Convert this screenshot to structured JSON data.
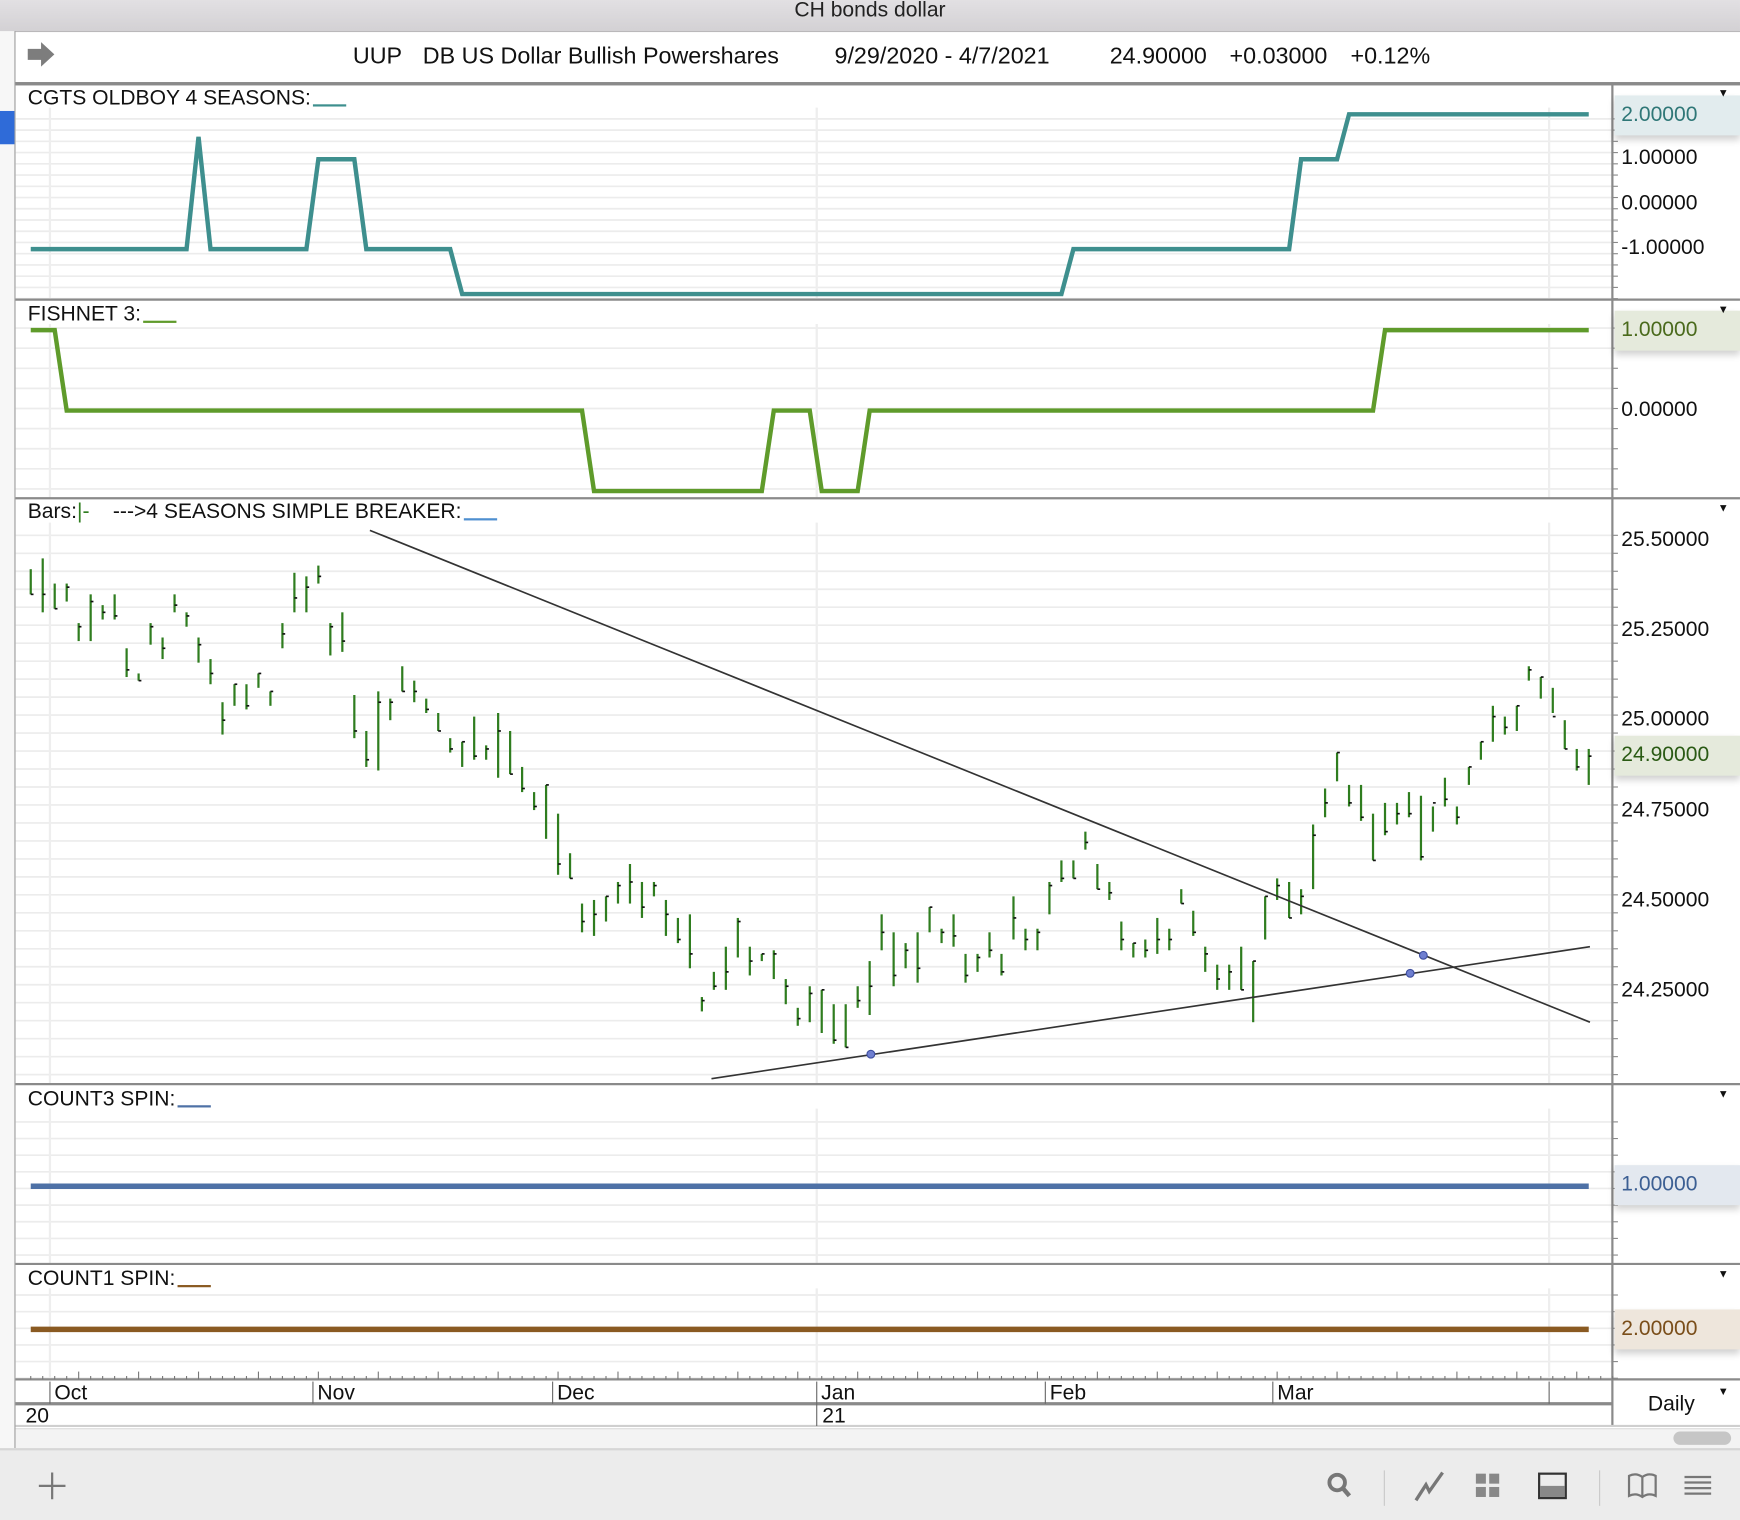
{
  "window": {
    "title": "CH bonds dollar"
  },
  "header": {
    "symbol": "UUP",
    "name": "DB US Dollar Bullish Powershares",
    "range": "9/29/2020 - 4/7/2021",
    "last": "24.90000",
    "change": "+0.03000",
    "pct": "+0.12%"
  },
  "colors": {
    "teal": "#3e8f8e",
    "fishnet": "#5f9b2b",
    "bars": "#2f7d1f",
    "count3": "#4e71a6",
    "count1": "#8a5a22",
    "accent": "#2f6bd8"
  },
  "panels": {
    "p1": {
      "label": "CGTS OLDBOY 4 SEASONS:",
      "ticks": [
        "1.00000",
        "0.00000",
        "-1.00000"
      ],
      "current": "2.00000"
    },
    "p2": {
      "label": "FISHNET 3:",
      "ticks": [
        "0.00000"
      ],
      "current": "1.00000"
    },
    "p3": {
      "label_bars": "Bars:",
      "label_bar_style": "|-",
      "label": "--->4 SEASONS SIMPLE BREAKER:",
      "ticks": [
        "25.50000",
        "25.25000",
        "25.00000",
        "24.75000",
        "24.50000",
        "24.25000"
      ],
      "current": "24.90000"
    },
    "p4": {
      "label": "COUNT3 SPIN:",
      "current": "1.00000"
    },
    "p5": {
      "label": "COUNT1 SPIN:",
      "current": "2.00000"
    }
  },
  "xaxis": {
    "months": [
      "Oct",
      "Nov",
      "Dec",
      "Jan",
      "Feb",
      "Mar"
    ],
    "years": [
      "20",
      "21"
    ],
    "interval": "Daily"
  },
  "toolbar": {
    "items": [
      "add",
      "search",
      "line-chart",
      "grid",
      "panel",
      "book",
      "menu"
    ]
  },
  "chart_data": {
    "type": "ohlc-bar",
    "title": "UUP DB US Dollar Bullish Powershares",
    "x_range": [
      "9/29/2020",
      "4/7/2021"
    ],
    "ylim": [
      24.0,
      25.6
    ],
    "bars_hlc": [
      [
        25.42,
        25.35,
        25.35
      ],
      [
        25.45,
        25.3,
        25.35
      ],
      [
        25.38,
        25.31,
        25.31
      ],
      [
        25.38,
        25.33,
        25.37
      ],
      [
        25.27,
        25.22,
        25.26
      ],
      [
        25.35,
        25.22,
        25.33
      ],
      [
        25.32,
        25.28,
        25.3
      ],
      [
        25.35,
        25.28,
        25.29
      ],
      [
        25.2,
        25.12,
        25.14
      ],
      [
        25.13,
        25.11,
        25.11
      ],
      [
        25.27,
        25.21,
        25.26
      ],
      [
        25.23,
        25.17,
        25.2
      ],
      [
        25.35,
        25.3,
        25.32
      ],
      [
        25.3,
        25.26,
        25.29
      ],
      [
        25.23,
        25.16,
        25.21
      ],
      [
        25.17,
        25.1,
        25.13
      ],
      [
        25.05,
        24.96,
        25.0
      ],
      [
        25.1,
        25.04,
        25.1
      ],
      [
        25.1,
        25.03,
        25.04
      ],
      [
        25.13,
        25.09,
        25.13
      ],
      [
        25.08,
        25.04,
        25.08
      ],
      [
        25.27,
        25.2,
        25.24
      ],
      [
        25.41,
        25.3,
        25.34
      ],
      [
        25.4,
        25.3,
        25.37
      ],
      [
        25.43,
        25.38,
        25.4
      ],
      [
        25.27,
        25.18,
        25.26
      ],
      [
        25.3,
        25.19,
        25.22
      ],
      [
        25.07,
        24.95,
        24.97
      ],
      [
        24.97,
        24.87,
        24.89
      ],
      [
        25.08,
        24.86,
        25.05
      ],
      [
        25.06,
        25.0,
        25.05
      ],
      [
        25.15,
        25.08,
        25.08
      ],
      [
        25.11,
        25.05,
        25.08
      ],
      [
        25.06,
        25.02,
        25.03
      ],
      [
        25.02,
        24.97,
        24.97
      ],
      [
        24.95,
        24.91,
        24.92
      ],
      [
        24.94,
        24.87,
        24.94
      ],
      [
        25.01,
        24.89,
        24.9
      ],
      [
        24.93,
        24.89,
        24.92
      ],
      [
        25.02,
        24.84,
        24.97
      ],
      [
        24.97,
        24.85,
        24.85
      ],
      [
        24.87,
        24.8,
        24.81
      ],
      [
        24.8,
        24.75,
        24.76
      ],
      [
        24.82,
        24.67,
        24.82
      ],
      [
        24.74,
        24.57,
        24.6
      ],
      [
        24.63,
        24.56,
        24.56
      ],
      [
        24.49,
        24.41,
        24.44
      ],
      [
        24.5,
        24.4,
        24.46
      ],
      [
        24.51,
        24.44,
        24.51
      ],
      [
        24.55,
        24.49,
        24.54
      ],
      [
        24.6,
        24.49,
        24.55
      ],
      [
        24.55,
        24.45,
        24.48
      ],
      [
        24.55,
        24.51,
        24.54
      ],
      [
        24.5,
        24.4,
        24.46
      ],
      [
        24.45,
        24.38,
        24.39
      ],
      [
        24.46,
        24.31,
        24.35
      ],
      [
        24.23,
        24.19,
        24.22
      ],
      [
        24.3,
        24.25,
        24.26
      ],
      [
        24.37,
        24.25,
        24.3
      ],
      [
        24.45,
        24.34,
        24.44
      ],
      [
        24.37,
        24.29,
        24.33
      ],
      [
        24.35,
        24.33,
        24.35
      ],
      [
        24.36,
        24.28,
        24.35
      ],
      [
        24.28,
        24.21,
        24.26
      ],
      [
        24.2,
        24.15,
        24.17
      ],
      [
        24.26,
        24.16,
        24.24
      ],
      [
        24.25,
        24.13,
        24.25
      ],
      [
        24.21,
        24.1,
        24.11
      ],
      [
        24.21,
        24.09,
        24.09
      ],
      [
        24.26,
        24.2,
        24.22
      ],
      [
        24.33,
        24.18,
        24.26
      ],
      [
        24.46,
        24.36,
        24.41
      ],
      [
        24.41,
        24.26,
        24.29
      ],
      [
        24.38,
        24.31,
        24.36
      ],
      [
        24.41,
        24.27,
        24.31
      ],
      [
        24.48,
        24.41,
        24.48
      ],
      [
        24.42,
        24.38,
        24.41
      ],
      [
        24.46,
        24.37,
        24.4
      ],
      [
        24.35,
        24.27,
        24.29
      ],
      [
        24.35,
        24.3,
        24.34
      ],
      [
        24.41,
        24.34,
        24.36
      ],
      [
        24.35,
        24.29,
        24.3
      ],
      [
        24.51,
        24.39,
        24.45
      ],
      [
        24.42,
        24.36,
        24.39
      ],
      [
        24.42,
        24.36,
        24.41
      ],
      [
        24.55,
        24.46,
        24.54
      ],
      [
        24.61,
        24.55,
        24.56
      ],
      [
        24.61,
        24.56,
        24.56
      ],
      [
        24.69,
        24.64,
        24.66
      ],
      [
        24.6,
        24.53,
        24.53
      ],
      [
        24.55,
        24.5,
        24.52
      ],
      [
        24.44,
        24.36,
        24.39
      ],
      [
        24.38,
        24.34,
        24.38
      ],
      [
        24.39,
        24.34,
        24.36
      ],
      [
        24.45,
        24.35,
        24.39
      ],
      [
        24.42,
        24.36,
        24.39
      ],
      [
        24.53,
        24.49,
        24.49
      ],
      [
        24.47,
        24.4,
        24.41
      ],
      [
        24.37,
        24.3,
        24.35
      ],
      [
        24.32,
        24.25,
        24.28
      ],
      [
        24.32,
        24.25,
        24.3
      ],
      [
        24.37,
        24.25,
        24.25
      ],
      [
        24.33,
        24.16,
        24.33
      ],
      [
        24.51,
        24.39,
        24.51
      ],
      [
        24.56,
        24.5,
        24.54
      ],
      [
        24.55,
        24.45,
        24.45
      ],
      [
        24.53,
        24.46,
        24.51
      ],
      [
        24.71,
        24.53,
        24.68
      ],
      [
        24.81,
        24.73,
        24.77
      ],
      [
        24.91,
        24.83,
        24.91
      ],
      [
        24.82,
        24.76,
        24.77
      ],
      [
        24.82,
        24.72,
        24.73
      ],
      [
        24.74,
        24.61,
        24.61
      ],
      [
        24.77,
        24.68,
        24.69
      ],
      [
        24.77,
        24.71,
        24.74
      ],
      [
        24.8,
        24.73,
        24.74
      ],
      [
        24.79,
        24.61,
        24.62
      ],
      [
        24.76,
        24.69,
        24.77
      ],
      [
        24.84,
        24.76,
        24.78
      ],
      [
        24.76,
        24.71,
        24.73
      ],
      [
        24.87,
        24.82,
        24.87
      ],
      [
        24.94,
        24.89,
        24.94
      ],
      [
        25.04,
        24.94,
        25.01
      ],
      [
        25.01,
        24.96,
        24.98
      ],
      [
        25.04,
        24.97,
        25.04
      ],
      [
        25.15,
        25.11,
        25.14
      ],
      [
        25.12,
        25.06,
        25.12
      ],
      [
        25.09,
        25.02,
        25.01
      ],
      [
        25.0,
        24.92,
        24.92
      ],
      [
        24.92,
        24.86,
        24.87
      ],
      [
        24.92,
        24.82,
        24.9
      ]
    ],
    "trendlines": [
      {
        "from": [
          29.3,
          25.528
        ],
        "to": [
          131.1,
          24.16
        ]
      },
      {
        "from": [
          57.8,
          24.003
        ],
        "to": [
          131.1,
          24.37
        ]
      }
    ],
    "anchors": [
      [
        71.1,
        24.071
      ],
      [
        116.1,
        24.296
      ],
      [
        117.2,
        24.346
      ]
    ],
    "indicators": {
      "cgts_oldboy": {
        "ylim": [
          -2,
          2
        ],
        "runs": [
          [
            1,
            14,
            -1
          ],
          [
            15,
            15,
            1.5
          ],
          [
            16,
            24,
            -1
          ],
          [
            25,
            28,
            1
          ],
          [
            29,
            36,
            -1
          ],
          [
            37,
            87,
            -2
          ],
          [
            88,
            106,
            -1
          ],
          [
            107,
            110,
            1
          ],
          [
            111,
            131,
            2
          ]
        ]
      },
      "fishnet3": {
        "ylim": [
          -1,
          1
        ],
        "runs": [
          [
            1,
            3,
            1
          ],
          [
            4,
            47,
            0
          ],
          [
            48,
            62,
            -1
          ],
          [
            63,
            66,
            0
          ],
          [
            67,
            70,
            -1
          ],
          [
            71,
            113,
            0
          ],
          [
            114,
            131,
            1
          ]
        ]
      },
      "count3_spin": {
        "runs": [
          [
            1,
            131,
            1
          ]
        ]
      },
      "count1_spin": {
        "runs": [
          [
            1,
            131,
            2
          ]
        ]
      }
    }
  }
}
